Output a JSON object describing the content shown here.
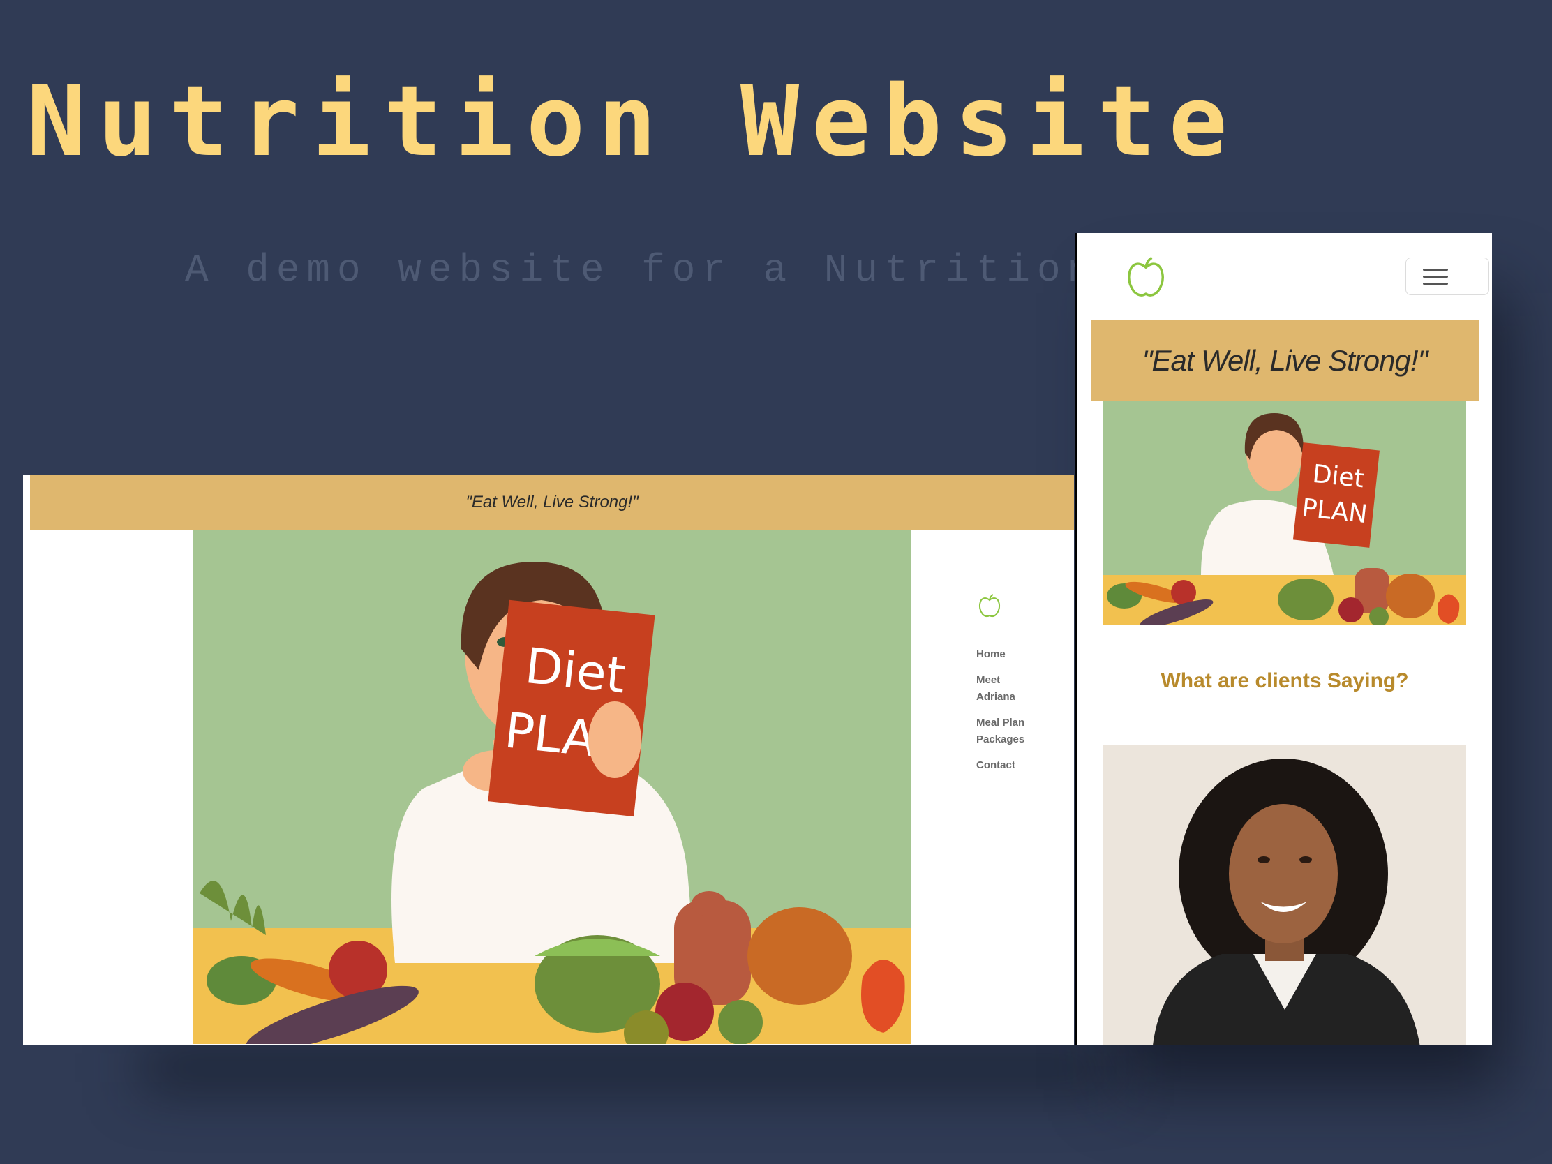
{
  "header": {
    "title": "Nutrition Website",
    "subtitle": "A demo website for a Nutritionist."
  },
  "desktop": {
    "banner_quote": "\"Eat Well, Live Strong!\"",
    "nav": {
      "logo": "apple-logo-icon",
      "items": [
        {
          "label": "Home"
        },
        {
          "label": "Meet Adriana"
        },
        {
          "label": "Meal Plan Packages"
        },
        {
          "label": "Contact"
        }
      ]
    },
    "hero": {
      "sign_line1": "Diet",
      "sign_line2": "PLAN"
    }
  },
  "mobile": {
    "logo": "apple-logo-icon",
    "menu": "hamburger-menu-icon",
    "banner_quote": "\"Eat Well, Live Strong!\"",
    "hero": {
      "sign_line1": "Diet",
      "sign_line2": "PLAN"
    },
    "testimonials_heading": "What are clients Saying?"
  },
  "colors": {
    "background": "#303b55",
    "title": "#fcd77c",
    "subtitle": "#4e5a74",
    "banner": "#dfb76e",
    "heading_gold": "#b88a2c",
    "logo_green": "#8cc63f"
  }
}
